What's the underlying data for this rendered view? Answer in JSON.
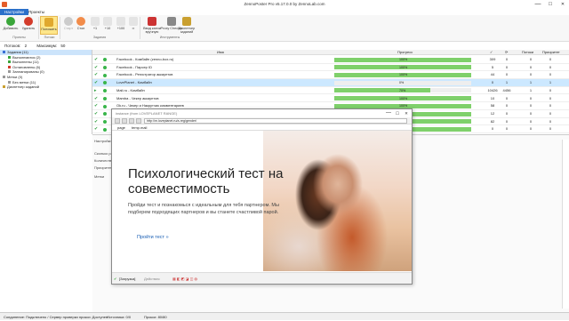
{
  "window": {
    "title": "ZennoPoster Pro v5.17.0.0 by ZennoLab.com",
    "minimize": "—",
    "maximize": "☐",
    "close": "✕"
  },
  "tabs": [
    {
      "label": "Настройки",
      "active": true
    },
    {
      "label": "Проекты",
      "active": false
    }
  ],
  "ribbon": {
    "buttons": [
      {
        "label": "Добавить",
        "icon": "plus-circle-icon",
        "color": "#3aa63a"
      },
      {
        "label": "Удалить",
        "icon": "minus-circle-icon",
        "color": "#d33b2a"
      },
      {
        "label": "Положить",
        "icon": "folder-icon",
        "color": "#e0a82e"
      },
      {
        "label": "Старт",
        "icon": "play-icon",
        "color": "#bbbbbb"
      },
      {
        "label": "Стоп",
        "icon": "stop-icon",
        "color": "#f28c4a"
      },
      {
        "label": "+1",
        "icon": "plus-one-icon",
        "color": "#666666"
      },
      {
        "label": "+10",
        "icon": "plus-ten-icon",
        "color": "#666666"
      },
      {
        "label": "+100",
        "icon": "plus-hundred-icon",
        "color": "#666666"
      },
      {
        "label": "∞",
        "icon": "infinity-icon",
        "color": "#666666"
      },
      {
        "label": "Ввод капчи вручную",
        "icon": "captcha-icon",
        "color": "#cc3333"
      },
      {
        "label": "Proxy Checker",
        "icon": "proxy-checker-icon",
        "color": "#888888"
      },
      {
        "label": "Диспетчер заданий",
        "icon": "task-manager-icon",
        "color": "#caa030"
      }
    ],
    "groups": [
      "Проекты",
      "Потоки",
      "Задания",
      "Инструменты"
    ]
  },
  "counters": {
    "threads_label": "Потоков:",
    "threads_value": "2",
    "max_label": "Максимум:",
    "max_value": "50"
  },
  "tree": [
    {
      "label": "Задания (11)",
      "level": 0,
      "selected": true,
      "color": "#3a6fd6"
    },
    {
      "label": "Выполняются (2)",
      "level": 1,
      "color": "#3aa63a"
    },
    {
      "label": "Выполнены (11)",
      "level": 1,
      "color": "#3aa63a"
    },
    {
      "label": "Остановлены (6)",
      "level": 1,
      "color": "#d33b2a"
    },
    {
      "label": "Запланированы (0)",
      "level": 1,
      "color": "#999999"
    },
    {
      "label": "Метки (0)",
      "level": 0,
      "color": "#999999"
    },
    {
      "label": "Без метки (11)",
      "level": 1,
      "color": "#999999"
    },
    {
      "label": "Диспетчер заданий",
      "level": 0,
      "color": "#caa030"
    }
  ],
  "grid": {
    "columns": [
      "Имя",
      "Прогресс",
      "✓",
      "⟳",
      "Потоки",
      "Приоритет"
    ],
    "rows": [
      {
        "checked": true,
        "name": "Facebook - Комбайн (zenno-box.ru)",
        "progress": 100,
        "progress_text": "100%",
        "c1": "309",
        "c2": "0",
        "c3": "0",
        "c4": "0",
        "selected": false
      },
      {
        "checked": true,
        "name": "Facebook - Парсер ID",
        "progress": 100,
        "progress_text": "100%",
        "c1": "5",
        "c2": "0",
        "c3": "0",
        "c4": "0",
        "selected": false
      },
      {
        "checked": true,
        "name": "Facebook - Регистратор аккаунтов",
        "progress": 100,
        "progress_text": "100%",
        "c1": "44",
        "c2": "0",
        "c3": "0",
        "c4": "0",
        "selected": false
      },
      {
        "checked": true,
        "name": "LovePlanet - Комбайн",
        "progress": 0,
        "progress_text": "0%",
        "c1": "0",
        "c2": "1",
        "c3": "1",
        "c4": "1",
        "selected": true
      },
      {
        "checked": false,
        "name": "Mail.ru - Комбайн",
        "progress": 70,
        "progress_text": "70%",
        "c1": "10426",
        "c2": "4456",
        "c3": "1",
        "c4": "0",
        "selected": false
      },
      {
        "checked": true,
        "name": "Mamba - Чекер аккаунтов",
        "progress": 100,
        "progress_text": "100%",
        "c1": "10",
        "c2": "0",
        "c3": "0",
        "c4": "0",
        "selected": false
      },
      {
        "checked": true,
        "name": "Ok.ru - Чекер и Накрутчик комментариев",
        "progress": 100,
        "progress_text": "100%",
        "c1": "58",
        "c2": "0",
        "c3": "0",
        "c4": "0",
        "selected": false
      },
      {
        "checked": true,
        "name": "",
        "progress": 100,
        "progress_text": "",
        "c1": "12",
        "c2": "0",
        "c3": "0",
        "c4": "0",
        "selected": false
      },
      {
        "checked": true,
        "name": "",
        "progress": 100,
        "progress_text": "",
        "c1": "82",
        "c2": "0",
        "c3": "0",
        "c4": "0",
        "selected": false
      },
      {
        "checked": true,
        "name": "",
        "progress": 100,
        "progress_text": "",
        "c1": "0",
        "c2": "0",
        "c3": "0",
        "c4": "0",
        "selected": false
      },
      {
        "checked": true,
        "name": "",
        "progress": 100,
        "progress_text": "",
        "c1": "357",
        "c2": "0",
        "c3": "0",
        "c4": "0",
        "selected": false
      }
    ]
  },
  "lower": {
    "tab_label": "Настройки",
    "fields": [
      "Сколько раз",
      "Количество",
      "Приоритет",
      "Метки"
    ]
  },
  "browser": {
    "title": "instance (from LOVEPLANET RANGE)",
    "url": "http://m.loveplanet.ru/a-reg/gender/",
    "tabs": [
      "page",
      "temp.mail"
    ],
    "headline": "Психологический тест на совеместимость",
    "body": "Пройди тест и познакомься с идеальным для тебя партнером. Мы подберем подходящих партнеров и вы станете счастливой парой.",
    "cta": "Пройти тест »",
    "status_left": "[Загрузка]",
    "status_mid": "Действия"
  },
  "statusbar": {
    "connection": "Соединение: Подключено / Сервер проверки прокси: Доступен",
    "sources": "Источники: 0/0",
    "proxy": "Прокси: 80/80"
  }
}
